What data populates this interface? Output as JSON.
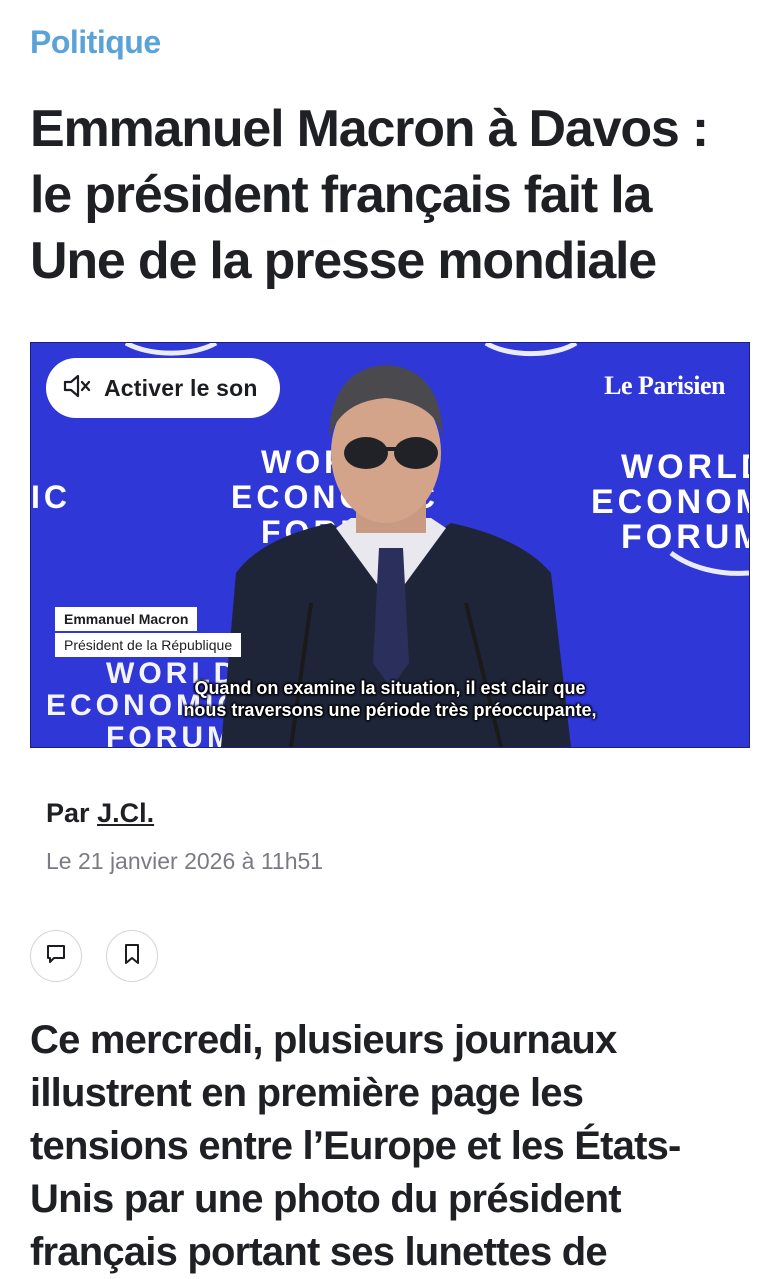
{
  "article": {
    "category": "Politique",
    "headline": "Emmanuel Macron à Davos : le président français fait la Une de la presse mondiale",
    "byline_prefix": "Par",
    "author": "J.Cl.",
    "date": "Le 21 janvier 2026 à 11h51",
    "lead": "Ce mercredi, plusieurs journaux illustrent en première page les tensions entre l’Europe et les États-Unis par une photo du président français portant ses lunettes de"
  },
  "video": {
    "sound_button_label": "Activer le son",
    "sound_icon": "speaker-muted-icon",
    "brand": "Le Parisien",
    "backdrop_text": [
      "WORLD",
      "ECONOMIC",
      "FORUM"
    ],
    "speaker_name": "Emmanuel Macron",
    "speaker_role": "Président de la République",
    "subtitle_line1": "Quand on examine la situation, il est clair que",
    "subtitle_line2": "nous traversons une période très préoccupante,"
  },
  "actions": {
    "comment_icon": "comment-icon",
    "bookmark_icon": "bookmark-icon"
  },
  "colors": {
    "category": "#5aa3d8",
    "video_background": "#2f37d6",
    "text": "#1f2024",
    "muted_text": "#7a7c82"
  }
}
